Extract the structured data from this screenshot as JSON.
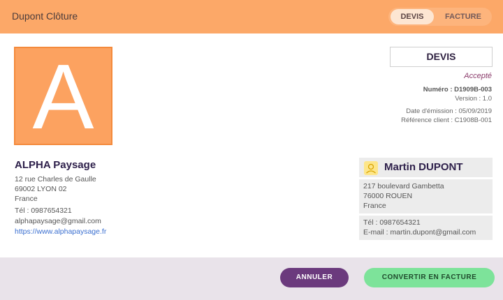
{
  "header": {
    "app_title": "Dupont Clôture",
    "toggle": {
      "devis": "DEVIS",
      "facture": "FACTURE",
      "selected": "DEVIS"
    }
  },
  "logo": {
    "letter": "A"
  },
  "document": {
    "type": "DEVIS",
    "status": "Accepté",
    "number": "Numéro : D1909B-003",
    "version": "Version : 1.0",
    "issue_date": "Date d'émission : 05/09/2019",
    "client_ref": "Référence client : C1908B-001"
  },
  "company": {
    "name": "ALPHA Paysage",
    "street": "12 rue Charles de Gaulle",
    "city": "69002 LYON 02",
    "country": "France",
    "phone": "Tél : 0987654321",
    "email": "alphapaysage@gmail.com",
    "website": "https://www.alphapaysage.fr"
  },
  "client": {
    "name": "Martin DUPONT",
    "street": "217 boulevard Gambetta",
    "city": "76000 ROUEN",
    "country": "France",
    "phone": "Tél : 0987654321",
    "email": "E-mail : martin.dupont@gmail.com"
  },
  "actions": {
    "cancel": "ANNULER",
    "convert": "CONVERTIR EN FACTURE"
  },
  "colors": {
    "header_bg": "#fca868",
    "accent_purple": "#6b3a7d",
    "accent_green": "#7de39a",
    "logo_bg": "#fca260"
  },
  "icons": {
    "client_avatar": "user-avatar-icon"
  }
}
